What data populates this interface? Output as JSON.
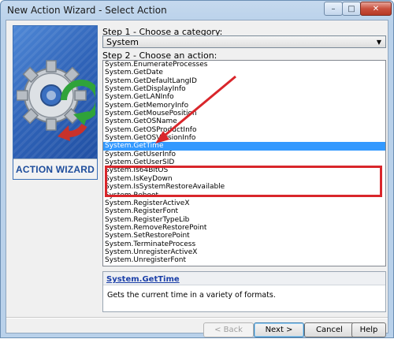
{
  "window": {
    "title": "New Action Wizard - Select Action",
    "controls": {
      "minimize": "–",
      "maximize": "□",
      "close": "✕"
    }
  },
  "banner": {
    "label": "ACTION WIZARD"
  },
  "step1": {
    "label": "Step 1 - Choose a category:",
    "selected": "System"
  },
  "step2": {
    "label": "Step 2 - Choose an action:",
    "items": [
      "System.EnumerateProcesses",
      "System.GetDate",
      "System.GetDefaultLangID",
      "System.GetDisplayInfo",
      "System.GetLANInfo",
      "System.GetMemoryInfo",
      "System.GetMousePosition",
      "System.GetOSName",
      "System.GetOSProductInfo",
      "System.GetOSVersionInfo",
      "System.GetTime",
      "System.GetUserInfo",
      "System.GetUserSID",
      "System.Is64BitOS",
      "System.IsKeyDown",
      "System.IsSystemRestoreAvailable",
      "System.Reboot",
      "System.RegisterActiveX",
      "System.RegisterFont",
      "System.RegisterTypeLib",
      "System.RemoveRestorePoint",
      "System.SetRestorePoint",
      "System.TerminateProcess",
      "System.UnregisterActiveX",
      "System.UnregisterFont"
    ],
    "selected_index": 10
  },
  "description": {
    "title": "System.GetTime",
    "text": "Gets the current time in a variety of formats."
  },
  "buttons": {
    "back": "< Back",
    "next": "Next >",
    "cancel": "Cancel",
    "help": "Help"
  },
  "colors": {
    "selection": "#3399ff",
    "annotation_red": "#d9262b",
    "link_blue": "#1b3fa8"
  }
}
